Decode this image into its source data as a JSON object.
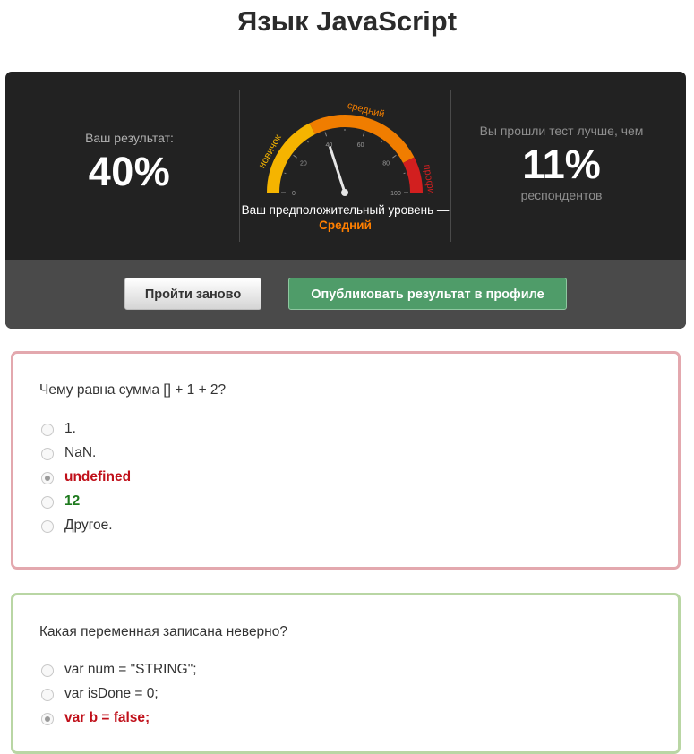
{
  "page": {
    "title": "Язык JavaScript"
  },
  "result": {
    "score_label": "Ваш результат:",
    "score_value": "40%",
    "better_label": "Вы прошли тест лучше, чем",
    "better_value": "11%",
    "better_sub": "респондентов"
  },
  "gauge": {
    "value": 40,
    "max": 100,
    "tick_labels": [
      "0",
      "20",
      "40",
      "60",
      "80",
      "100"
    ],
    "zones": [
      {
        "label": "новичок",
        "color": "#f5b400"
      },
      {
        "label": "средний",
        "color": "#f07d00"
      },
      {
        "label": "профи",
        "color": "#d21f1f"
      }
    ],
    "level_prefix": "Ваш предположительный уровень —",
    "level_value": "Средний",
    "level_color": "#ff7f00"
  },
  "actions": {
    "retry_label": "Пройти заново",
    "publish_label": "Опубликовать результат в профиле",
    "publish_color": "#4f9c69"
  },
  "questions": [
    {
      "text": "Чему равна сумма [] + 1 + 2?",
      "border_color": "#e3a8ae",
      "options": [
        {
          "label": "1.",
          "state": "normal",
          "checked": false
        },
        {
          "label": "NaN.",
          "state": "normal",
          "checked": false
        },
        {
          "label": "undefined",
          "state": "wrong",
          "checked": true
        },
        {
          "label": "12",
          "state": "right",
          "checked": false
        },
        {
          "label": "Другое.",
          "state": "normal",
          "checked": false
        }
      ]
    },
    {
      "text": "Какая переменная записана неверно?",
      "border_color": "#b9d6a4",
      "options": [
        {
          "label": "var num = \"STRING\";",
          "state": "normal",
          "checked": false
        },
        {
          "label": "var isDone = 0;",
          "state": "normal",
          "checked": false
        },
        {
          "label": "var b = false;",
          "state": "wrong",
          "checked": true
        }
      ]
    }
  ]
}
